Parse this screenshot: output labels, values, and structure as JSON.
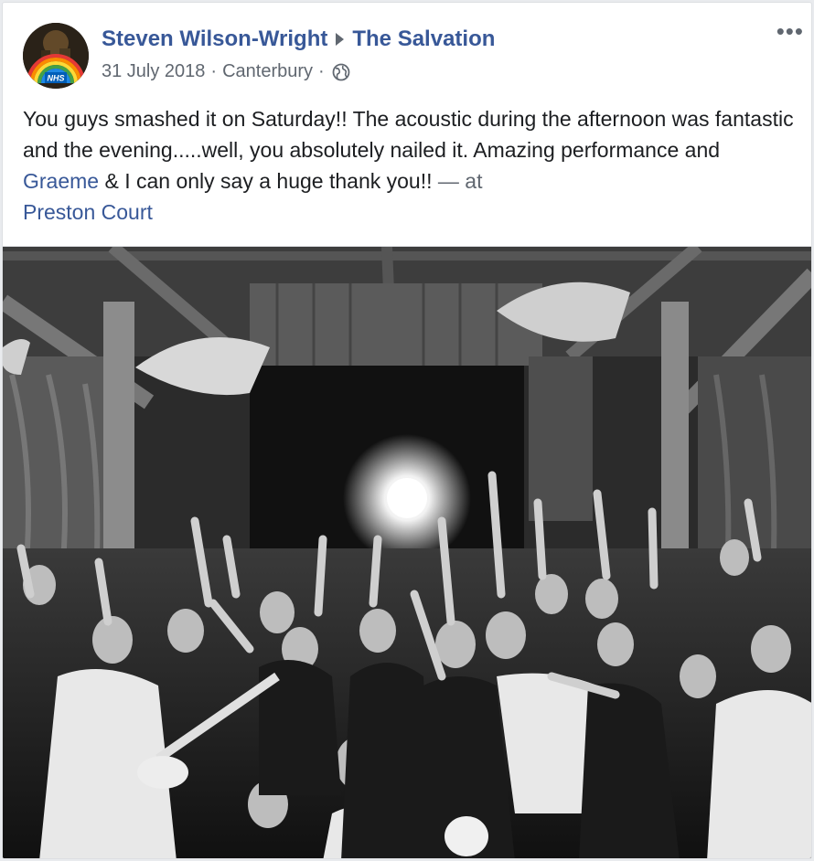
{
  "post": {
    "author": "Steven Wilson-Wright",
    "target_page": "The Salvation",
    "date": "31 July 2018",
    "location": "Canterbury",
    "separator": "·",
    "more_label": "•••",
    "text_part1": "You guys smashed it on Saturday!! The acoustic during the afternoon was fantastic and the evening.....well, you absolutely nailed it. Amazing performance and ",
    "tagged_person": "Graeme",
    "text_part2": " & I can only say a huge thank you!!",
    "at_prefix": " — at",
    "place": "Preston Court",
    "avatar_badge": "NHS"
  },
  "colors": {
    "link": "#385898",
    "text": "#1c1e21",
    "meta": "#606770"
  },
  "icons": {
    "privacy": "globe-icon",
    "more": "more-options-icon",
    "separator_arrow": "triangle-right-icon"
  }
}
